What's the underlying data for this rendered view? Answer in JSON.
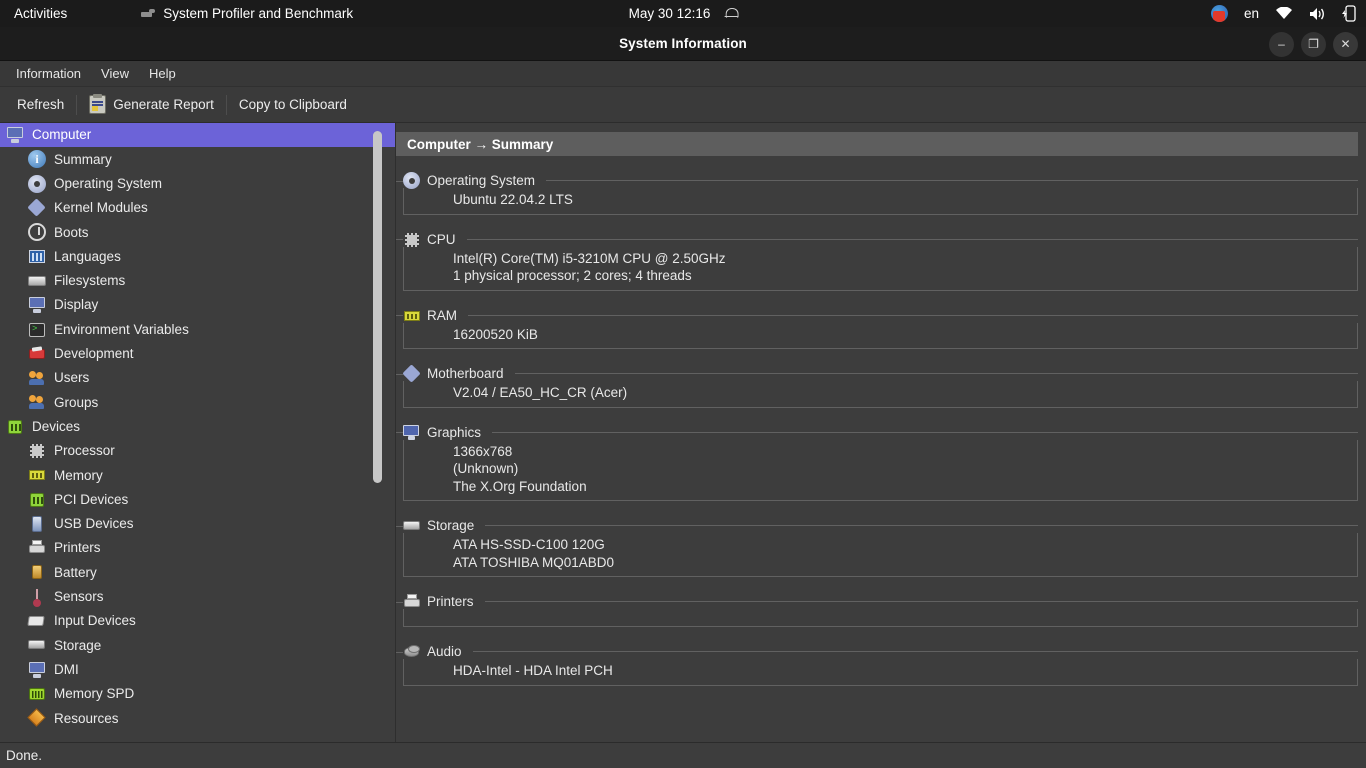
{
  "topbar": {
    "activities": "Activities",
    "app_name": "System Profiler and Benchmark",
    "clock": "May 30  12:16",
    "lang": "en",
    "icons": [
      "hand-pointer-icon",
      "bell-icon",
      "notification-badge-icon",
      "wifi-icon",
      "volume-icon",
      "battery-icon"
    ]
  },
  "window": {
    "title": "System Information",
    "minimize": "–",
    "maximize": "❐",
    "close": "✕"
  },
  "menubar": {
    "items": [
      {
        "label": "Information"
      },
      {
        "label": "View"
      },
      {
        "label": "Help"
      }
    ]
  },
  "toolbar": {
    "refresh_label": "Refresh",
    "generate_report_label": "Generate Report",
    "copy_clipboard_label": "Copy to Clipboard"
  },
  "sidebar": {
    "items": [
      {
        "label": "Computer",
        "icon": "computer-icon",
        "indent": false,
        "selected": true
      },
      {
        "label": "Summary",
        "icon": "info-icon",
        "indent": true,
        "selected": false
      },
      {
        "label": "Operating System",
        "icon": "gear-icon",
        "indent": true,
        "selected": false
      },
      {
        "label": "Kernel Modules",
        "icon": "diamond-icon",
        "indent": true,
        "selected": false
      },
      {
        "label": "Boots",
        "icon": "power-icon",
        "indent": true,
        "selected": false
      },
      {
        "label": "Languages",
        "icon": "language-icon",
        "indent": true,
        "selected": false
      },
      {
        "label": "Filesystems",
        "icon": "drive-icon",
        "indent": true,
        "selected": false
      },
      {
        "label": "Display",
        "icon": "monitor-icon",
        "indent": true,
        "selected": false
      },
      {
        "label": "Environment Variables",
        "icon": "terminal-icon",
        "indent": true,
        "selected": false
      },
      {
        "label": "Development",
        "icon": "development-icon",
        "indent": true,
        "selected": false
      },
      {
        "label": "Users",
        "icon": "users-icon",
        "indent": true,
        "selected": false
      },
      {
        "label": "Groups",
        "icon": "groups-icon",
        "indent": true,
        "selected": false
      },
      {
        "label": "Devices",
        "icon": "devices-chip-icon",
        "indent": false,
        "selected": false
      },
      {
        "label": "Processor",
        "icon": "cpu-icon",
        "indent": true,
        "selected": false
      },
      {
        "label": "Memory",
        "icon": "memory-icon",
        "indent": true,
        "selected": false
      },
      {
        "label": "PCI Devices",
        "icon": "pci-chip-icon",
        "indent": true,
        "selected": false
      },
      {
        "label": "USB Devices",
        "icon": "usb-icon",
        "indent": true,
        "selected": false
      },
      {
        "label": "Printers",
        "icon": "printer-icon",
        "indent": true,
        "selected": false
      },
      {
        "label": "Battery",
        "icon": "battery-icon",
        "indent": true,
        "selected": false
      },
      {
        "label": "Sensors",
        "icon": "sensor-icon",
        "indent": true,
        "selected": false
      },
      {
        "label": "Input Devices",
        "icon": "input-device-icon",
        "indent": true,
        "selected": false
      },
      {
        "label": "Storage",
        "icon": "storage-icon",
        "indent": true,
        "selected": false
      },
      {
        "label": "DMI",
        "icon": "monitor-icon",
        "indent": true,
        "selected": false
      },
      {
        "label": "Memory SPD",
        "icon": "memory-spd-icon",
        "indent": true,
        "selected": false
      },
      {
        "label": "Resources",
        "icon": "resources-icon",
        "indent": true,
        "selected": false
      }
    ]
  },
  "content": {
    "breadcrumb": "Computer → Summary",
    "groups": [
      {
        "title": "Operating System",
        "icon": "gear-icon",
        "lines": [
          "Ubuntu 22.04.2 LTS"
        ]
      },
      {
        "title": "CPU",
        "icon": "cpu-icon",
        "lines": [
          "Intel(R) Core(TM) i5-3210M CPU @ 2.50GHz",
          "1 physical processor; 2 cores; 4 threads"
        ]
      },
      {
        "title": "RAM",
        "icon": "memory-icon",
        "lines": [
          "16200520 KiB"
        ]
      },
      {
        "title": "Motherboard",
        "icon": "diamond-icon",
        "lines": [
          "V2.04 / EA50_HC_CR (Acer)"
        ]
      },
      {
        "title": "Graphics",
        "icon": "monitor-icon",
        "lines": [
          "1366x768",
          "(Unknown)",
          "The X.Org Foundation"
        ]
      },
      {
        "title": "Storage",
        "icon": "storage-icon",
        "lines": [
          "ATA HS-SSD-C100 120G",
          "ATA TOSHIBA MQ01ABD0"
        ]
      },
      {
        "title": "Printers",
        "icon": "printer-icon",
        "lines": []
      },
      {
        "title": "Audio",
        "icon": "audio-icon",
        "lines": [
          "HDA-Intel - HDA Intel PCH"
        ]
      }
    ]
  },
  "statusbar": {
    "text": "Done."
  },
  "colors": {
    "selection": "#6c63d8",
    "window_bg": "#3d3d3d",
    "breadcrumb_bg": "#5e5e5e",
    "topbar_bg": "#1b1b1b",
    "titlebar_bg": "#1d1d1d"
  }
}
